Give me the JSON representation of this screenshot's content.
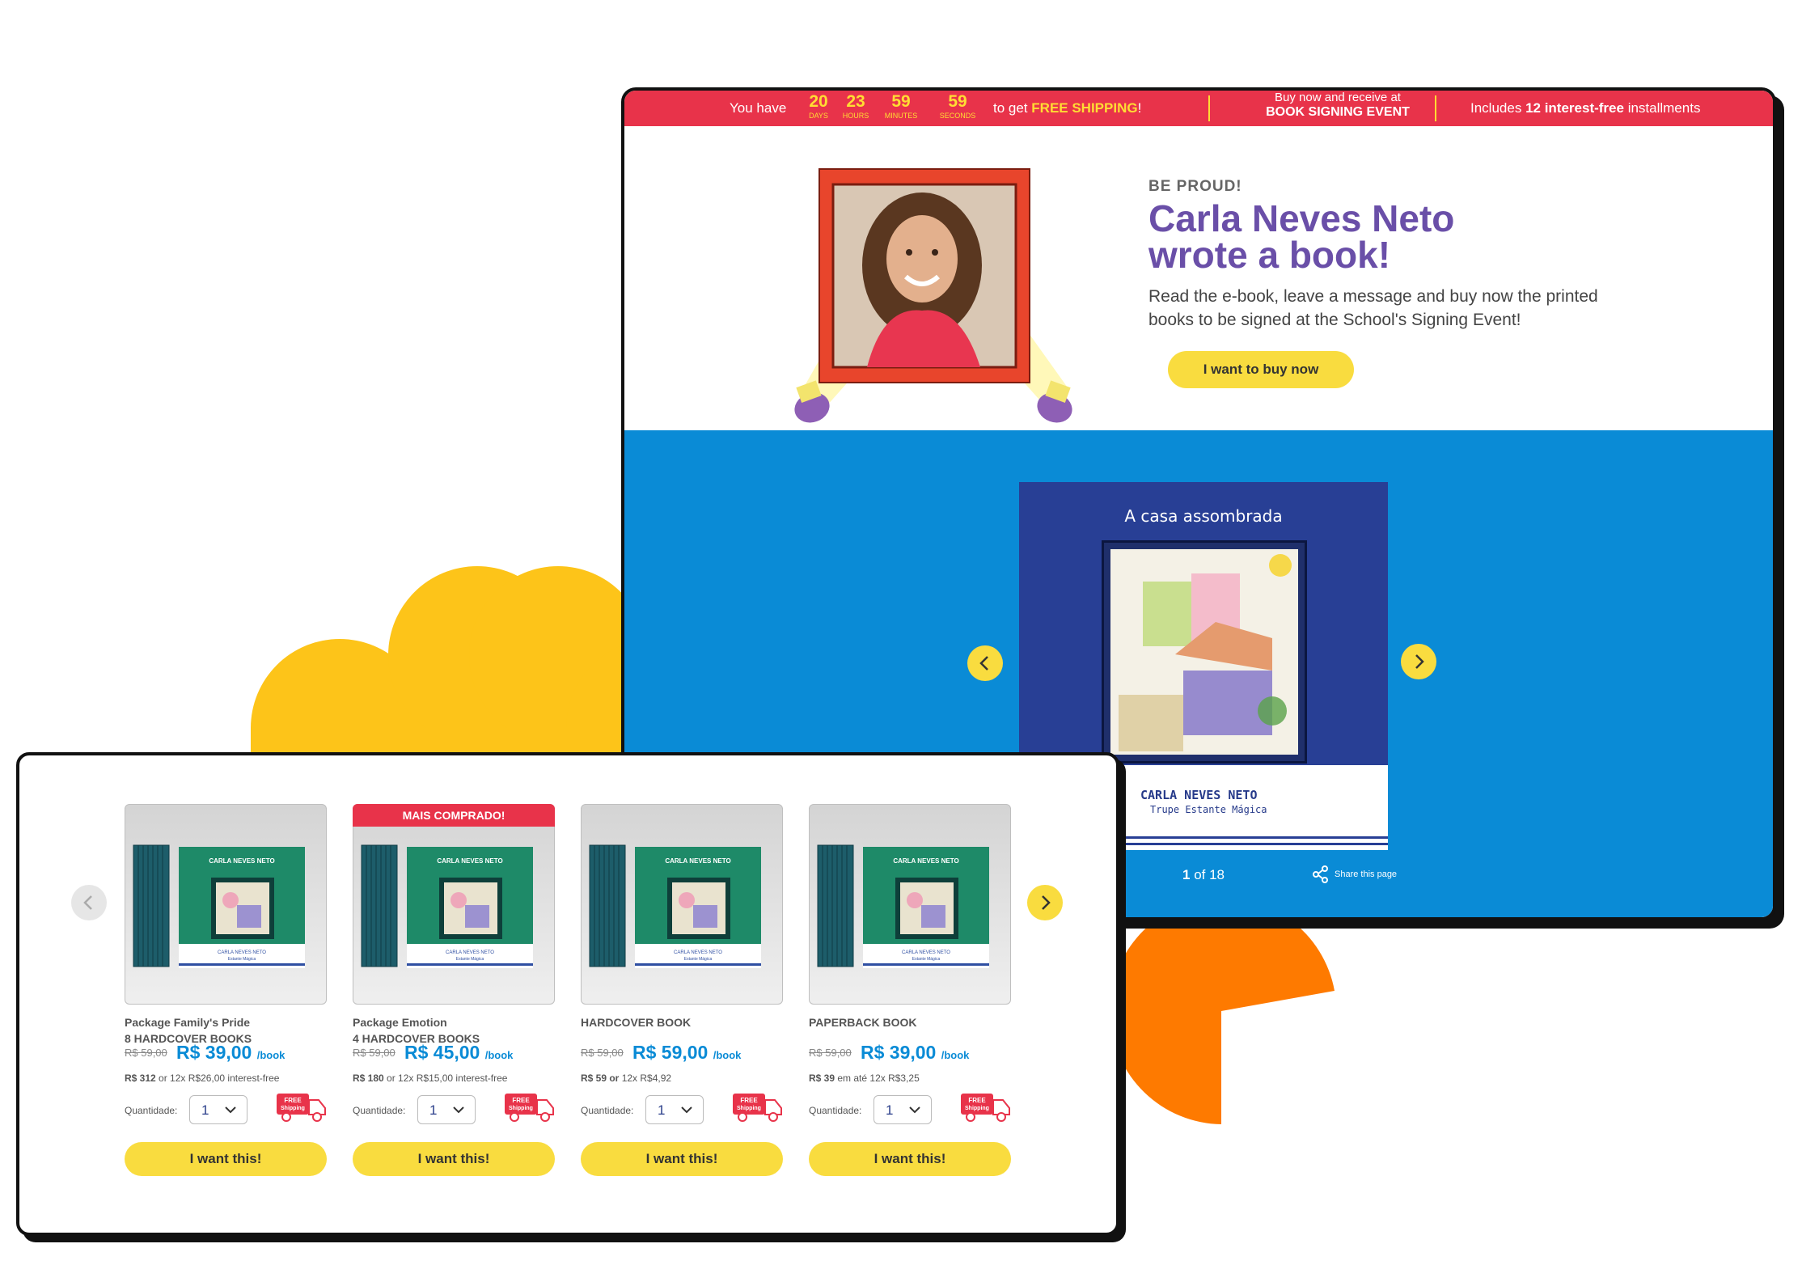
{
  "promo_bar": {
    "prefix": "You have",
    "countdown": [
      {
        "value": "20",
        "unit": "DAYS"
      },
      {
        "value": "23",
        "unit": "HOURS"
      },
      {
        "value": "59",
        "unit": "MINUTES"
      },
      {
        "value": "59",
        "unit": "SECONDS"
      }
    ],
    "suffix": "to get",
    "shipping_label": "FREE SHIPPING",
    "shipping_exclaim": "!",
    "signing_line1": "Buy now and receive at",
    "signing_line2": "BOOK SIGNING EVENT",
    "installments_prefix": "Includes",
    "installments_bold": "12 interest-free",
    "installments_suffix": "installments"
  },
  "hero": {
    "eyebrow": "BE PROUD!",
    "title_line1": "Carla Neves Neto",
    "title_line2": "wrote a book!",
    "description": "Read the e-book, leave a message and buy now the printed books to be signed at the School's Signing Event!",
    "cta_label": "I want to buy now"
  },
  "ebook": {
    "title": "A casa assombrada",
    "author": "CARLA NEVES NETO",
    "series": "Trupe Estante Mágica",
    "page_current": "1",
    "page_total": "of 18",
    "share_label": "Share this page"
  },
  "products": [
    {
      "badge": "",
      "name_line1": "Package Family's Pride",
      "name_line2": "8 HARDCOVER BOOKS",
      "old_price": "R$ 59,00",
      "price": "R$ 39,00",
      "per": "/book",
      "installment_bold": "R$ 312",
      "installment_rest": "or 12x R$26,00 interest-free",
      "qty_label": "Quantidade:",
      "qty": "1",
      "cta": "I want this!"
    },
    {
      "badge": "MAIS COMPRADO!",
      "name_line1": "Package Emotion",
      "name_line2": "4 HARDCOVER BOOKS",
      "old_price": "R$ 59,00",
      "price": "R$ 45,00",
      "per": "/book",
      "installment_bold": "R$ 180",
      "installment_rest": "or 12x R$15,00 interest-free",
      "qty_label": "Quantidade:",
      "qty": "1",
      "cta": "I want this!"
    },
    {
      "badge": "",
      "name_line1": "HARDCOVER BOOK",
      "name_line2": "",
      "old_price": "R$ 59,00",
      "price": "R$ 59,00",
      "per": "/book",
      "installment_bold": "R$ 59 or",
      "installment_rest": "12x R$4,92",
      "qty_label": "Quantidade:",
      "qty": "1",
      "cta": "I want this!"
    },
    {
      "badge": "",
      "name_line1": "PAPERBACK BOOK",
      "name_line2": "",
      "old_price": "R$ 59,00",
      "price": "R$ 39,00",
      "per": "/book",
      "installment_bold": "R$ 39",
      "installment_rest": "em até 12x R$3,25",
      "qty_label": "Quantidade:",
      "qty": "1",
      "cta": "I want this!"
    }
  ],
  "mini_book": {
    "author": "CARLA NEVES NETO",
    "series": "Estante Mágica"
  },
  "free_ship_icon_text": "FREE Shipping",
  "colors": {
    "accent_yellow": "#f9dc3f",
    "promo_red": "#e8334a",
    "brand_blue": "#0a8bd6",
    "title_purple": "#6a4fa8",
    "cloud_yellow": "#fdc419",
    "pacman_orange": "#fe7a00"
  }
}
